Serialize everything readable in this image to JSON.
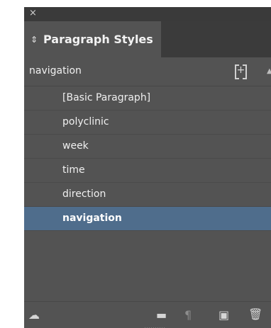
{
  "window": {
    "close_label": "×"
  },
  "panel": {
    "tab_icon": "⇕",
    "tab_title": "Paragraph Styles",
    "current_style": "navigation",
    "new_group_icon": "+",
    "scroll_up_icon": "▲"
  },
  "styles": {
    "items": [
      {
        "label": "[Basic Paragraph]",
        "selected": false
      },
      {
        "label": "polyclinic",
        "selected": false
      },
      {
        "label": "week",
        "selected": false
      },
      {
        "label": "time",
        "selected": false
      },
      {
        "label": "direction",
        "selected": false
      },
      {
        "label": "navigation",
        "selected": true
      }
    ]
  },
  "footer": {
    "icons": [
      {
        "name": "cloud-library-icon",
        "glyph": "☁"
      },
      {
        "name": "folder-icon",
        "glyph": "▬"
      },
      {
        "name": "clear-overrides-icon",
        "glyph": "¶"
      },
      {
        "name": "new-style-icon",
        "glyph": "▣"
      },
      {
        "name": "trash-icon",
        "glyph": "🗑"
      }
    ]
  },
  "colors": {
    "panel_bg": "#535353",
    "selected_row": "#4f6d8c",
    "text": "#f0f0f0"
  }
}
